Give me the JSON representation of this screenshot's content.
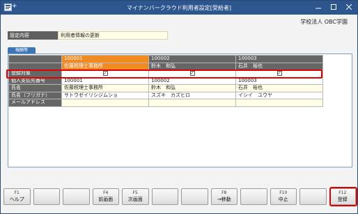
{
  "titlebar": {
    "plus": "+",
    "title": "マイナンバークラウド利用者設定[受給者]"
  },
  "company": "学校法人 OBC学園",
  "setting": {
    "label": "設定内容",
    "value": "利用者情報の更新"
  },
  "panel": {
    "tab": "報酬等"
  },
  "table": {
    "columns": [
      {
        "code": "100001",
        "name": "佐藤税理士事務所"
      },
      {
        "code": "100002",
        "name": "鈴木　和弘"
      },
      {
        "code": "100003",
        "name": "石井　裕也"
      }
    ],
    "rows": [
      {
        "label": "登録対象",
        "values": [
          "✓",
          "✓",
          "✓"
        ]
      },
      {
        "label": "個人支払先番号",
        "values": [
          "100001",
          "100002",
          "100003"
        ]
      },
      {
        "label": "氏名",
        "values": [
          "佐藤税理士事務所",
          "鈴木　和弘",
          "石井　裕也"
        ]
      },
      {
        "label": "氏名（フリガナ）",
        "values": [
          "サトウゼイリシジムショ",
          "スズキ　カズヒロ",
          "イシイ　ユウヤ"
        ]
      },
      {
        "label": "メールアドレス",
        "values": [
          "",
          "",
          ""
        ]
      }
    ]
  },
  "fkeys": [
    {
      "num": "F1",
      "label": "ヘルプ"
    },
    {
      "num": "",
      "label": ""
    },
    {
      "num": "",
      "label": ""
    },
    {
      "num": "F4",
      "label": "前画面"
    },
    {
      "num": "F5",
      "label": "次画面"
    },
    {
      "num": "",
      "label": ""
    },
    {
      "num": "",
      "label": ""
    },
    {
      "num": "F8",
      "label": "→移動"
    },
    {
      "num": "",
      "label": ""
    },
    {
      "num": "F10",
      "label": "中止"
    },
    {
      "num": "",
      "label": ""
    },
    {
      "num": "F12",
      "label": "登録"
    }
  ]
}
